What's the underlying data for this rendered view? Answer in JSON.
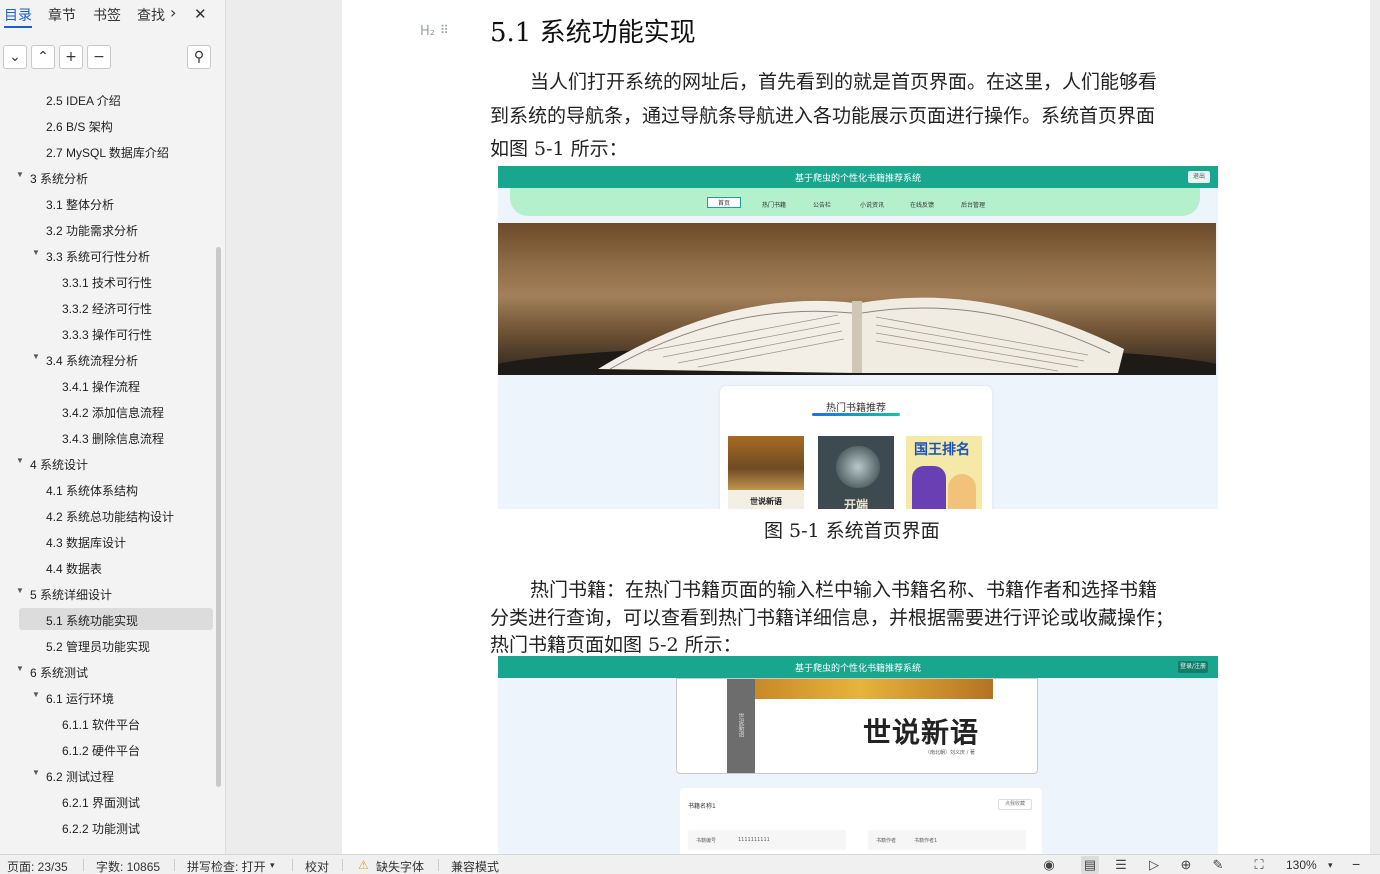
{
  "nav": {
    "tabs": [
      "目录",
      "章节",
      "书签",
      "查找"
    ],
    "more_glyph": "›",
    "close_glyph": "✕",
    "tools": [
      "chevron-down-icon",
      "chevron-up-icon",
      "plus-icon",
      "minus-icon"
    ],
    "tool_glyphs": [
      "⌄",
      "⌃",
      "+",
      "−"
    ],
    "settings_glyph": "⚲",
    "toc": [
      {
        "label": "2.5 IDEA 介绍",
        "level": 2,
        "expander": ""
      },
      {
        "label": "2.6 B/S 架构",
        "level": 2,
        "expander": ""
      },
      {
        "label": "2.7 MySQL 数据库介绍",
        "level": 2,
        "expander": ""
      },
      {
        "label": "3 系统分析",
        "level": 1,
        "expander": "▼"
      },
      {
        "label": "3.1 整体分析",
        "level": 2,
        "expander": ""
      },
      {
        "label": "3.2 功能需求分析",
        "level": 2,
        "expander": ""
      },
      {
        "label": "3.3  系统可行性分析",
        "level": 2,
        "expander": "▼"
      },
      {
        "label": "3.3.1 技术可行性",
        "level": 3,
        "expander": ""
      },
      {
        "label": "3.3.2 经济可行性",
        "level": 3,
        "expander": ""
      },
      {
        "label": "3.3.3 操作可行性",
        "level": 3,
        "expander": ""
      },
      {
        "label": "3.4 系统流程分析",
        "level": 2,
        "expander": "▼"
      },
      {
        "label": "3.4.1 操作流程",
        "level": 3,
        "expander": ""
      },
      {
        "label": "3.4.2 添加信息流程",
        "level": 3,
        "expander": ""
      },
      {
        "label": "3.4.3 删除信息流程",
        "level": 3,
        "expander": ""
      },
      {
        "label": "4  系统设计",
        "level": 1,
        "expander": "▼"
      },
      {
        "label": "4.1  系统体系结构",
        "level": 2,
        "expander": ""
      },
      {
        "label": "4.2  系统总功能结构设计",
        "level": 2,
        "expander": ""
      },
      {
        "label": "4.3  数据库设计",
        "level": 2,
        "expander": ""
      },
      {
        "label": "4.4  数据表",
        "level": 2,
        "expander": ""
      },
      {
        "label": "5  系统详细设计",
        "level": 1,
        "expander": "▼"
      },
      {
        "label": "5.1 系统功能实现",
        "level": 2,
        "expander": "",
        "active": true
      },
      {
        "label": "5.2 管理员功能实现",
        "level": 2,
        "expander": ""
      },
      {
        "label": "6    系统测试",
        "level": 1,
        "expander": "▼"
      },
      {
        "label": "6.1 运行环境",
        "level": 2,
        "expander": "▼"
      },
      {
        "label": "6.1.1 软件平台",
        "level": 3,
        "expander": ""
      },
      {
        "label": "6.1.2  硬件平台",
        "level": 3,
        "expander": ""
      },
      {
        "label": "6.2 测试过程",
        "level": 2,
        "expander": "▼"
      },
      {
        "label": "6.2.1  界面测试",
        "level": 3,
        "expander": ""
      },
      {
        "label": "6.2.2  功能测试",
        "level": 3,
        "expander": ""
      }
    ]
  },
  "doc": {
    "heading_marker": "H₂",
    "drag_handle": "⠿",
    "heading": "5.1 系统功能实现",
    "para1": [
      "当人们打开系统的网址后，首先看到的就是首页界面。在这里，人们能够看",
      "到系统的导航条，通过导航条导航进入各功能展示页面进行操作。系统首页界面",
      "如图 5-1 所示："
    ],
    "fig1": {
      "site_title": "基于爬虫的个性化书籍推荐系统",
      "logout": "退出",
      "menu": [
        "首页",
        "热门书籍",
        "公告栏",
        "小说资讯",
        "在线反馈",
        "后台管理"
      ],
      "section_title": "热门书籍推荐",
      "covers": [
        "世说新语",
        "开端",
        "国王排名"
      ]
    },
    "caption1": "图 5-1  系统首页界面",
    "para2": [
      "热门书籍：在热门书籍页面的输入栏中输入书籍名称、书籍作者和选择书籍",
      "分类进行查询，可以查看到热门书籍详细信息，并根据需要进行评论或收藏操作；",
      "热门书籍页面如图 5-2 所示："
    ],
    "fig2": {
      "site_title": "基于爬虫的个性化书籍推荐系统",
      "login": "登录/注册",
      "book_title": "世说新语",
      "book_sub": "（南北朝）刘义庆 / 著",
      "spine": "世说新语",
      "detail_title": "书籍名称1",
      "fav": "点我收藏",
      "fields": [
        {
          "k": "书籍编号",
          "v": "1111111111"
        },
        {
          "k": "书籍作者",
          "v": "书籍作者1"
        }
      ]
    }
  },
  "statusbar": {
    "page": "页面: 23/35",
    "words": "字数: 10865",
    "spell": "拼写检查: 打开",
    "proof": "校对",
    "missing_font": "缺失字体",
    "compat": "兼容模式",
    "zoom": "130%"
  },
  "colors": {
    "accent": "#1a5fd1",
    "site_header": "#18a68f",
    "site_nav": "#b5f0cd"
  }
}
